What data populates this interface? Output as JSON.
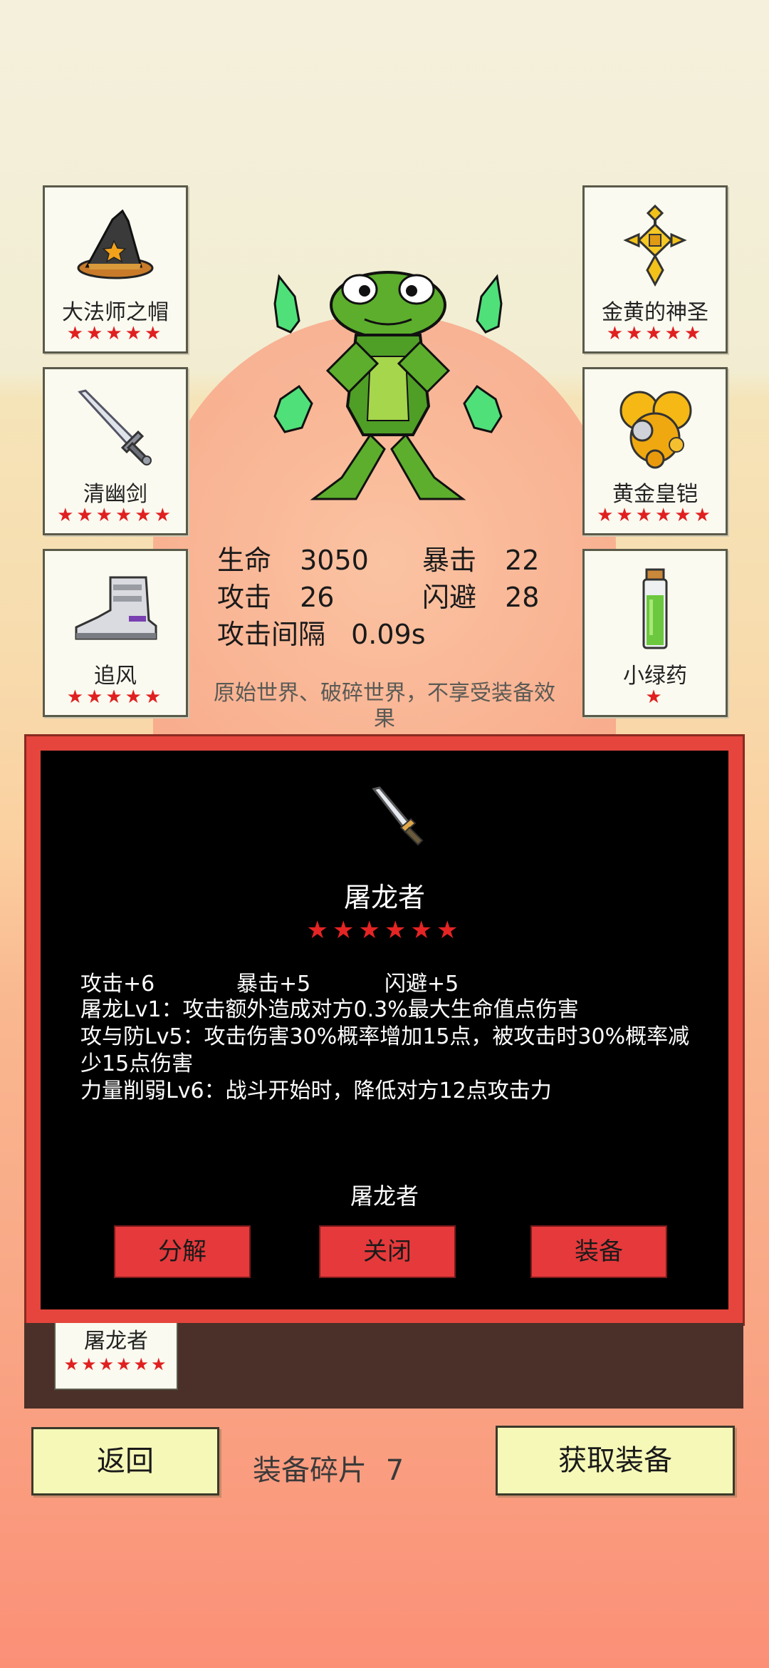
{
  "equipment_left": [
    {
      "name": "大法师之帽",
      "stars": "★★★★★",
      "icon": "wizard-hat-icon"
    },
    {
      "name": "清幽剑",
      "stars": "★★★★★★",
      "icon": "sword-icon"
    },
    {
      "name": "追风",
      "stars": "★★★★★",
      "icon": "boot-icon"
    }
  ],
  "equipment_right": [
    {
      "name": "金黄的神圣",
      "stars": "★★★★★",
      "icon": "holy-amulet-icon"
    },
    {
      "name": "黄金皇铠",
      "stars": "★★★★★★",
      "icon": "gold-armor-icon"
    },
    {
      "name": "小绿药",
      "stars": "★",
      "icon": "green-potion-icon"
    }
  ],
  "stats": {
    "hp_label": "生命",
    "hp_value": "3050",
    "crit_label": "暴击",
    "crit_value": "22",
    "atk_label": "攻击",
    "atk_value": "26",
    "dodge_label": "闪避",
    "dodge_value": "28",
    "interval_label": "攻击间隔",
    "interval_value": "0.09s"
  },
  "note": "原始世界、破碎世界，不享受装备效果",
  "dialog": {
    "item_name": "屠龙者",
    "stars": "★★★★★★",
    "attrs": [
      "攻击+6",
      "暴击+5",
      "闪避+5"
    ],
    "skills": [
      "屠龙Lv1：攻击额外造成对方0.3%最大生命值点伤害",
      "攻与防Lv5：攻击伤害30%概率增加15点，被攻击时30%概率减少15点伤害",
      "力量削弱Lv6：战斗开始时，降低对方12点攻击力"
    ],
    "sub_name": "屠龙者",
    "btn_decompose": "分解",
    "btn_close": "关闭",
    "btn_equip": "装备"
  },
  "inventory": [
    {
      "name": "屠龙者",
      "stars": "★★★★★★"
    }
  ],
  "bottom": {
    "back_label": "返回",
    "fragments_label": "装备碎片",
    "fragments_count": "7",
    "get_label": "获取装备"
  },
  "colors": {
    "star_red": "#e02020",
    "button_red": "#e5393b",
    "dialog_border": "#e5453c",
    "button_yellow": "#f6f8b8"
  }
}
